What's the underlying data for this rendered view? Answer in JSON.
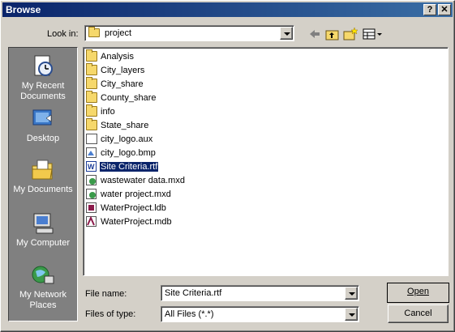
{
  "window": {
    "title": "Browse"
  },
  "title_buttons": {
    "help": "?",
    "close": "✕"
  },
  "look_in": {
    "label": "Look in:",
    "value": "project"
  },
  "places": [
    {
      "label": "My Recent Documents",
      "icon": "recent-documents-icon"
    },
    {
      "label": "Desktop",
      "icon": "desktop-icon"
    },
    {
      "label": "My Documents",
      "icon": "my-documents-icon"
    },
    {
      "label": "My Computer",
      "icon": "my-computer-icon"
    },
    {
      "label": "My Network Places",
      "icon": "network-places-icon"
    }
  ],
  "files": [
    {
      "name": "Analysis",
      "type": "folder"
    },
    {
      "name": "City_layers",
      "type": "folder"
    },
    {
      "name": "City_share",
      "type": "folder"
    },
    {
      "name": "County_share",
      "type": "folder"
    },
    {
      "name": "info",
      "type": "folder"
    },
    {
      "name": "State_share",
      "type": "folder"
    },
    {
      "name": "city_logo.aux",
      "type": "file"
    },
    {
      "name": "city_logo.bmp",
      "type": "image"
    },
    {
      "name": "Site Criteria.rtf",
      "type": "rtf",
      "selected": true
    },
    {
      "name": "wastewater data.mxd",
      "type": "mxd"
    },
    {
      "name": "water project.mxd",
      "type": "mxd"
    },
    {
      "name": "WaterProject.ldb",
      "type": "ldb"
    },
    {
      "name": "WaterProject.mdb",
      "type": "mdb"
    }
  ],
  "file_name": {
    "label": "File name:",
    "value": "Site Criteria.rtf"
  },
  "files_of_type": {
    "label": "Files of type:",
    "value": "All Files (*.*)"
  },
  "buttons": {
    "open": "Open",
    "cancel": "Cancel"
  },
  "colors": {
    "title_start": "#0a246a",
    "title_end": "#3a6ea5",
    "selection": "#0a246a",
    "face": "#d4d0c8"
  }
}
